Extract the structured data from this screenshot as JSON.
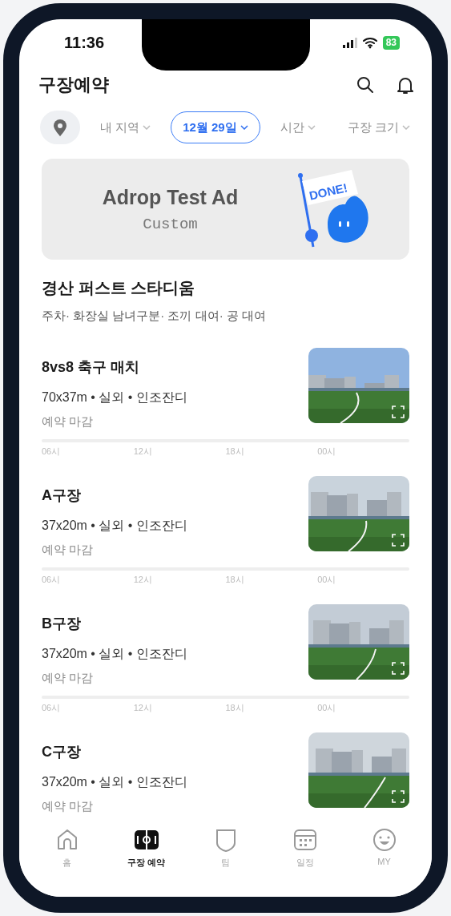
{
  "status_bar": {
    "time": "11:36",
    "battery": "83"
  },
  "header": {
    "title": "구장예약"
  },
  "filters": [
    {
      "kind": "location"
    },
    {
      "kind": "chip",
      "label": "내 지역",
      "selected": false
    },
    {
      "kind": "chip",
      "label": "12월 29일",
      "selected": true
    },
    {
      "kind": "chip",
      "label": "시간",
      "selected": false
    },
    {
      "kind": "chip",
      "label": "구장 크기",
      "selected": false
    }
  ],
  "ad": {
    "title": "Adrop Test Ad",
    "subtitle": "Custom",
    "flag_text": "DONE!"
  },
  "venue": {
    "name": "경산 퍼스트 스타디움",
    "amenities": "주차· 화장실 남녀구분· 조끼 대여· 공 대여"
  },
  "fields": [
    {
      "name": "8vs8 축구 매치",
      "spec": "70x37m • 실외 • 인조잔디",
      "status": "예약 마감",
      "timeline": [
        "06시",
        "12시",
        "18시",
        "00시"
      ],
      "photo": {
        "kind": "picture"
      }
    },
    {
      "name": "A구장",
      "spec": "37x20m • 실외 • 인조잔디",
      "status": "예약 마감",
      "timeline": [
        "06시",
        "12시",
        "18시",
        "00시"
      ],
      "photo": {
        "kind": "picture"
      }
    },
    {
      "name": "B구장",
      "spec": "37x20m • 실외 • 인조잔디",
      "status": "예약 마감",
      "timeline": [
        "06시",
        "12시",
        "18시",
        "00시"
      ],
      "photo": {
        "kind": "picture"
      }
    },
    {
      "name": "C구장",
      "spec": "37x20m • 실외 • 인조잔디",
      "status": "예약 마감",
      "photo": {
        "kind": "picture"
      }
    }
  ],
  "tab_bar": [
    {
      "kind": "home",
      "label": "홈",
      "selected": false
    },
    {
      "kind": "field",
      "label": "구장 예약",
      "selected": true
    },
    {
      "kind": "team",
      "label": "팀",
      "selected": false
    },
    {
      "kind": "schedule",
      "label": "일정",
      "selected": false
    },
    {
      "kind": "my",
      "label": "MY",
      "selected": false
    }
  ]
}
